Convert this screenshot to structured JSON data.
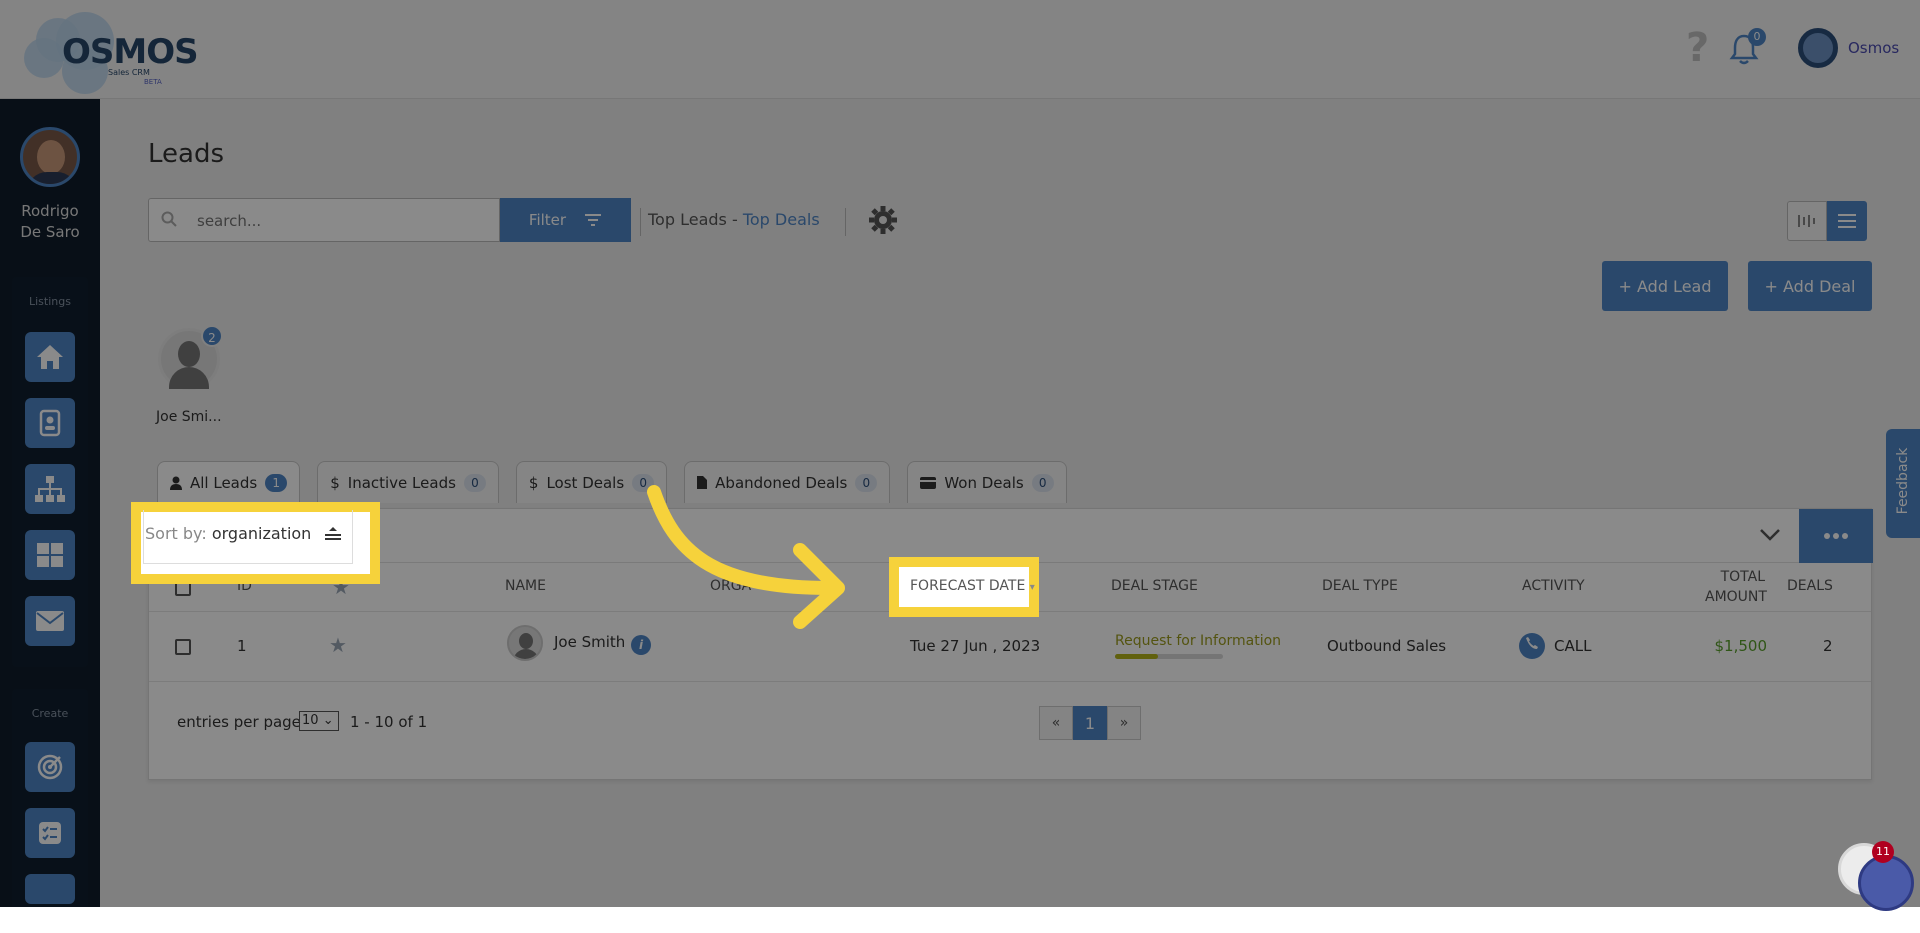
{
  "brand": {
    "name": "OSMOS",
    "subtitle": "Sales CRM",
    "beta": "BETA"
  },
  "topbar": {
    "help_icon": "?",
    "notifications_count": "0",
    "user_label": "Osmos"
  },
  "sidebar": {
    "user_first": "Rodrigo",
    "user_last": "De Saro",
    "listings_label": "Listings",
    "create_label": "Create",
    "listing_icons": [
      "home-icon",
      "contact-card-icon",
      "org-chart-icon",
      "grid-icon",
      "mail-icon"
    ],
    "create_icons": [
      "target-icon",
      "checklist-icon"
    ]
  },
  "page": {
    "title": "Leads"
  },
  "search": {
    "placeholder": "search..."
  },
  "filter": {
    "label": "Filter"
  },
  "links": {
    "top_leads": "Top Leads",
    "separator": "-",
    "top_deals": "Top Deals"
  },
  "buttons": {
    "add_lead": "+ Add Lead",
    "add_deal": "+ Add Deal"
  },
  "lead_card": {
    "name": "Joe Smi...",
    "badge": "2"
  },
  "tabs": [
    {
      "label": "All Leads",
      "count": "1",
      "icon": "user-icon"
    },
    {
      "label": "Inactive Leads",
      "count": "0",
      "icon": "dollar-icon"
    },
    {
      "label": "Lost Deals",
      "count": "0",
      "icon": "dollar-icon"
    },
    {
      "label": "Abandoned Deals",
      "count": "0",
      "icon": "file-icon"
    },
    {
      "label": "Won Deals",
      "count": "0",
      "icon": "card-icon"
    }
  ],
  "sort": {
    "label": "Sort by:",
    "value": "organization"
  },
  "table": {
    "headers": {
      "id": "ID",
      "name": "NAME",
      "organization": "ORGA",
      "forecast_date": "FORECAST DATE",
      "deal_stage": "DEAL STAGE",
      "deal_type": "DEAL TYPE",
      "activity": "ACTIVITY",
      "total_amount_1": "TOTAL",
      "total_amount_2": "AMOUNT",
      "deals": "DEALS"
    },
    "rows": [
      {
        "id": "1",
        "name": "Joe Smith",
        "forecast_date": "Tue 27 Jun , 2023",
        "deal_stage": "Request for Information",
        "deal_stage_progress": 0.4,
        "deal_type": "Outbound Sales",
        "activity": "CALL",
        "total_amount": "$1,500",
        "deals": "2"
      }
    ]
  },
  "pager": {
    "entries_label": "entries per page",
    "per_page": "10",
    "range": "1 - 10 of 1",
    "prev": "«",
    "current": "1",
    "next": "»"
  },
  "feedback": {
    "label": "Feedback"
  },
  "chat": {
    "badge": "11"
  },
  "colors": {
    "accent": "#4f86c6",
    "highlight": "#f6d23b",
    "amount": "#5aa02c",
    "stage": "#9b9b1e"
  }
}
